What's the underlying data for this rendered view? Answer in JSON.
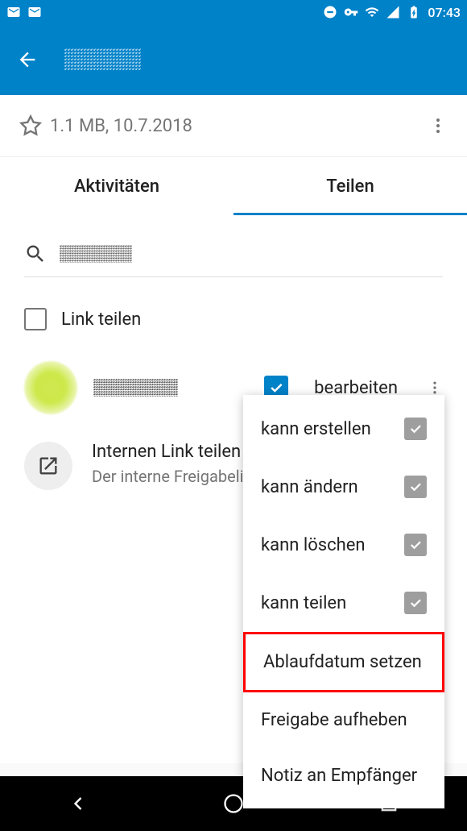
{
  "status_bar": {
    "time": "07:43"
  },
  "file": {
    "size": "1.1 MB",
    "date": "10.7.2018"
  },
  "tabs": {
    "activity": "Aktivitäten",
    "share": "Teilen"
  },
  "share": {
    "link_label": "Link teilen",
    "edit_label": "bearbeiten",
    "internal_link_title": "Internen Link teilen",
    "internal_link_desc": "Der interne Freigabelink Benutzer mit Zugriff au"
  },
  "popup": {
    "can_create": "kann erstellen",
    "can_change": "kann ändern",
    "can_delete": "kann löschen",
    "can_share": "kann teilen",
    "set_expiry": "Ablaufdatum setzen",
    "unshare": "Freigabe aufheben",
    "note": "Notiz an Empfänger"
  }
}
